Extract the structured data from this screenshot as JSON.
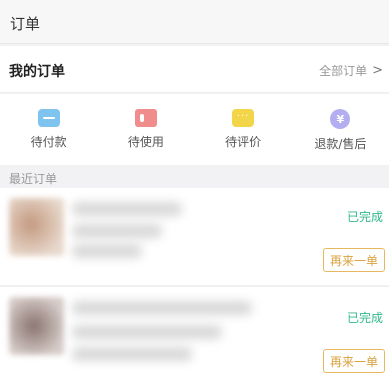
{
  "header": {
    "title": "订单"
  },
  "my_orders": {
    "title": "我的订单",
    "all_link": "全部订单",
    "chevron": ">"
  },
  "status_tabs": [
    {
      "label": "待付款",
      "icon": "wallet-icon",
      "color": "#7ec4ef"
    },
    {
      "label": "待使用",
      "icon": "ticket-icon",
      "color": "#f08c8c"
    },
    {
      "label": "待评价",
      "icon": "comment-icon",
      "color": "#f3d54a"
    },
    {
      "label": "退款/售后",
      "icon": "yen-refund-icon",
      "color": "#b3aeef"
    }
  ],
  "refund_icon_glyph": "¥",
  "recent_section": {
    "label": "最近订单"
  },
  "orders": [
    {
      "status": "已完成",
      "action": "再来一单"
    },
    {
      "status": "已完成",
      "action": "再来一单"
    }
  ],
  "colors": {
    "completed": "#30b98a",
    "reorder": "#d9a13d"
  }
}
